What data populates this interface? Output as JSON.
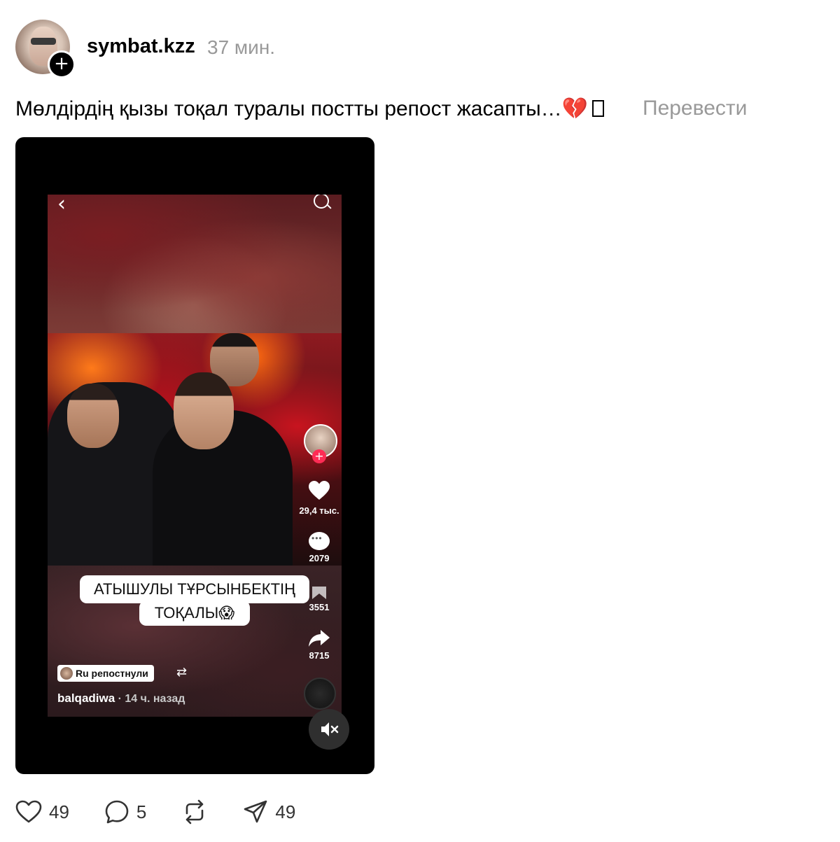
{
  "post": {
    "username": "symbat.kzz",
    "time": "37 мин.",
    "caption": "Мөлдірдің қызы тоқал туралы постты репост жасапты…",
    "caption_emoji": "💔",
    "translate_label": "Перевести"
  },
  "video": {
    "overlay_line1": "АТЫШУЛЫ ТҰРСЫНБЕКТІҢ",
    "overlay_line2": "ТОҚАЛЫ😱",
    "likes": "29,4 тыс.",
    "comments": "2079",
    "saves": "3551",
    "shares": "8715",
    "repost_label": "Ru репостнули",
    "author": "balqadiwa",
    "author_time": " · 14 ч. назад",
    "icons": [
      "back-icon",
      "search-icon",
      "heart-icon",
      "comment-icon",
      "bookmark-icon",
      "share-icon",
      "mute-icon",
      "repost-icon"
    ]
  },
  "actions": {
    "like_count": "49",
    "comment_count": "5",
    "share_count": "49",
    "icons": [
      "heart-icon",
      "comment-icon",
      "repost-icon",
      "send-icon"
    ]
  },
  "colors": {
    "muted_text": "#999999",
    "card_bg": "#000000",
    "accent_red": "#fe2c55",
    "heart_red": "#c8102e"
  }
}
